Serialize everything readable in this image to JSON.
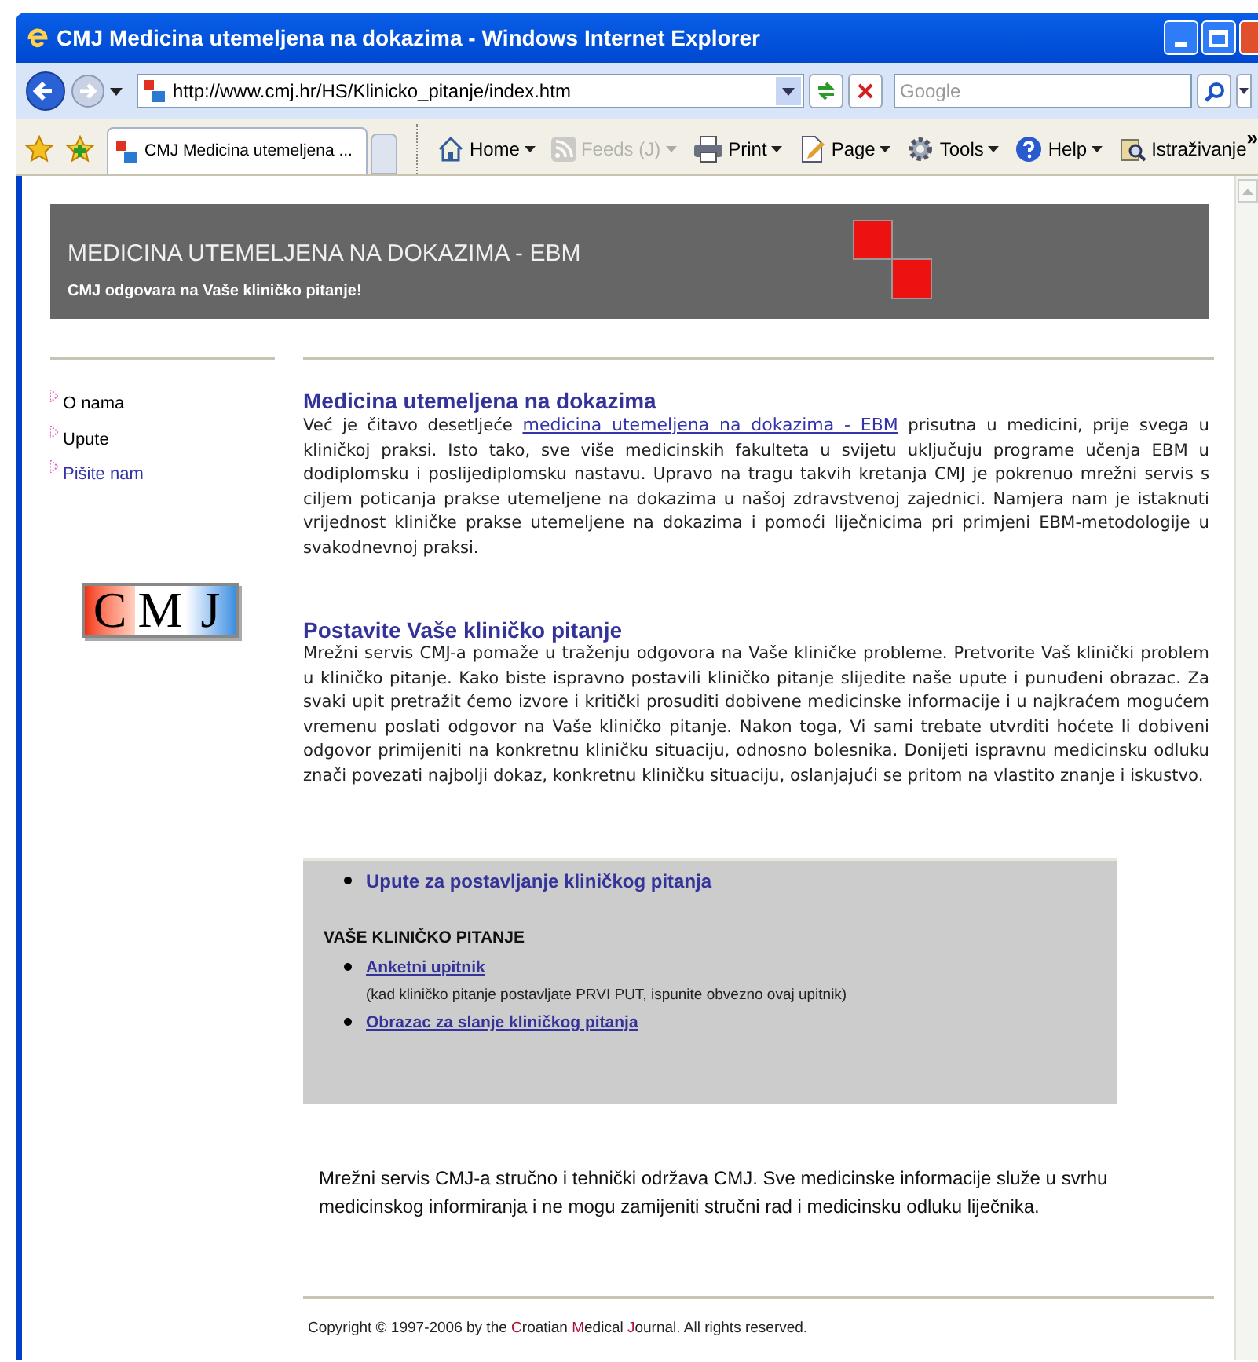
{
  "window": {
    "title": "CMJ Medicina utemeljena na dokazima - Windows Internet Explorer"
  },
  "address_bar": {
    "url": "http://www.cmj.hr/HS/Klinicko_pitanje/index.htm"
  },
  "search": {
    "placeholder": "Google"
  },
  "tabs": [
    {
      "label": "CMJ Medicina utemeljena ...",
      "selected": true
    }
  ],
  "command_bar": [
    {
      "kind": "home",
      "label": "Home",
      "disabled": false,
      "dropdown": true
    },
    {
      "kind": "feeds",
      "label": "Feeds (J)",
      "disabled": true,
      "dropdown": true
    },
    {
      "kind": "print",
      "label": "Print",
      "disabled": false,
      "dropdown": true
    },
    {
      "kind": "page",
      "label": "Page",
      "disabled": false,
      "dropdown": true
    },
    {
      "kind": "tools",
      "label": "Tools",
      "disabled": false,
      "dropdown": true
    },
    {
      "kind": "help",
      "label": "Help",
      "disabled": false,
      "dropdown": true
    },
    {
      "kind": "research",
      "label": "Istraživanje",
      "disabled": false,
      "dropdown": false
    }
  ],
  "overflow": "»",
  "header": {
    "title": "MEDICINA UTEMELJENA NA DOKAZIMA - EBM",
    "subtitle": "CMJ odgovara na Vaše kliničko pitanje!"
  },
  "sidebar": {
    "items": [
      {
        "label": "O nama",
        "visited": true
      },
      {
        "label": "Upute",
        "visited": true
      },
      {
        "label": "Pišite nam",
        "visited": false
      }
    ],
    "logo": [
      "C",
      "M",
      "J"
    ]
  },
  "sections": [
    {
      "heading": "Medicina utemeljena na dokazima",
      "parts": [
        {
          "text": "Već je čitavo desetljeće ",
          "link": false
        },
        {
          "text": "medicina utemeljena na dokazima - EBM",
          "link": true
        },
        {
          "text": " prisutna u medicini, prije svega u kliničkoj praksi. Isto tako, sve više medicinskih fakulteta u svijetu uključuju programe učenja EBM u dodiplomsku i poslijediplomsku nastavu. Upravo na tragu takvih kretanja CMJ je pokrenuo mrežni servis s ciljem poticanja prakse utemeljene na dokazima u našoj zdravstvenoj zajednici. Namjera nam je istaknuti vrijednost kliničke prakse utemeljene na dokazima i pomoći liječnicima pri primjeni EBM-metodologije u svakodnevnoj praksi.",
          "link": false
        }
      ]
    },
    {
      "heading": "Postavite Vaše kliničko pitanje",
      "parts": [
        {
          "text": "Mrežni servis CMJ-a pomaže u traženju odgovora na Vaše kliničke probleme. Pretvorite Vaš klinički problem u kliničko pitanje. Kako biste ispravno postavili kliničko pitanje slijedite naše upute i punuđeni obrazac. Za svaki upit pretražit ćemo izvore i kritički prosuditi dobivene medicinske informacije i u najkraćem mogućem vremenu poslati odgovor na Vaše kliničko pitanje. Nakon toga, Vi sami trebate utvrditi hoćete li dobiveni odgovor primijeniti na konkretnu kliničku situaciju, odnosno bolesnika. Donijeti ispravnu medicinsku odluku znači povezati najbolji dokaz, konkretnu kliničku situaciju, oslanjajući se pritom na vlastito znanje i iskustvo.",
          "link": false
        }
      ]
    }
  ],
  "box": {
    "guide_link": "Upute za postavljanje kliničkog pitanja",
    "heading": "VAŠE KLINIČKO PITANJE",
    "links": [
      {
        "label": "Anketni upitnik",
        "note": "(kad kliničko pitanje postavljate PRVI PUT, ispunite obvezno ovaj upitnik)"
      },
      {
        "label": "Obrazac za slanje kliničkog pitanja"
      }
    ]
  },
  "disclaimer": "Mrežni servis CMJ-a stručno i tehnički održava CMJ. Sve medicinske informacije služe u svrhu medicinskog informiranja i ne mogu zamijeniti stručni rad i medicinsku odluku liječnika.",
  "copyright": [
    {
      "text": "Copyright © 1997-2006 by the ",
      "accent": false
    },
    {
      "text": "C",
      "accent": true
    },
    {
      "text": "roatian ",
      "accent": false
    },
    {
      "text": "M",
      "accent": true
    },
    {
      "text": "edical ",
      "accent": false
    },
    {
      "text": "J",
      "accent": true
    },
    {
      "text": "ournal. All rights reserved.",
      "accent": false
    }
  ]
}
